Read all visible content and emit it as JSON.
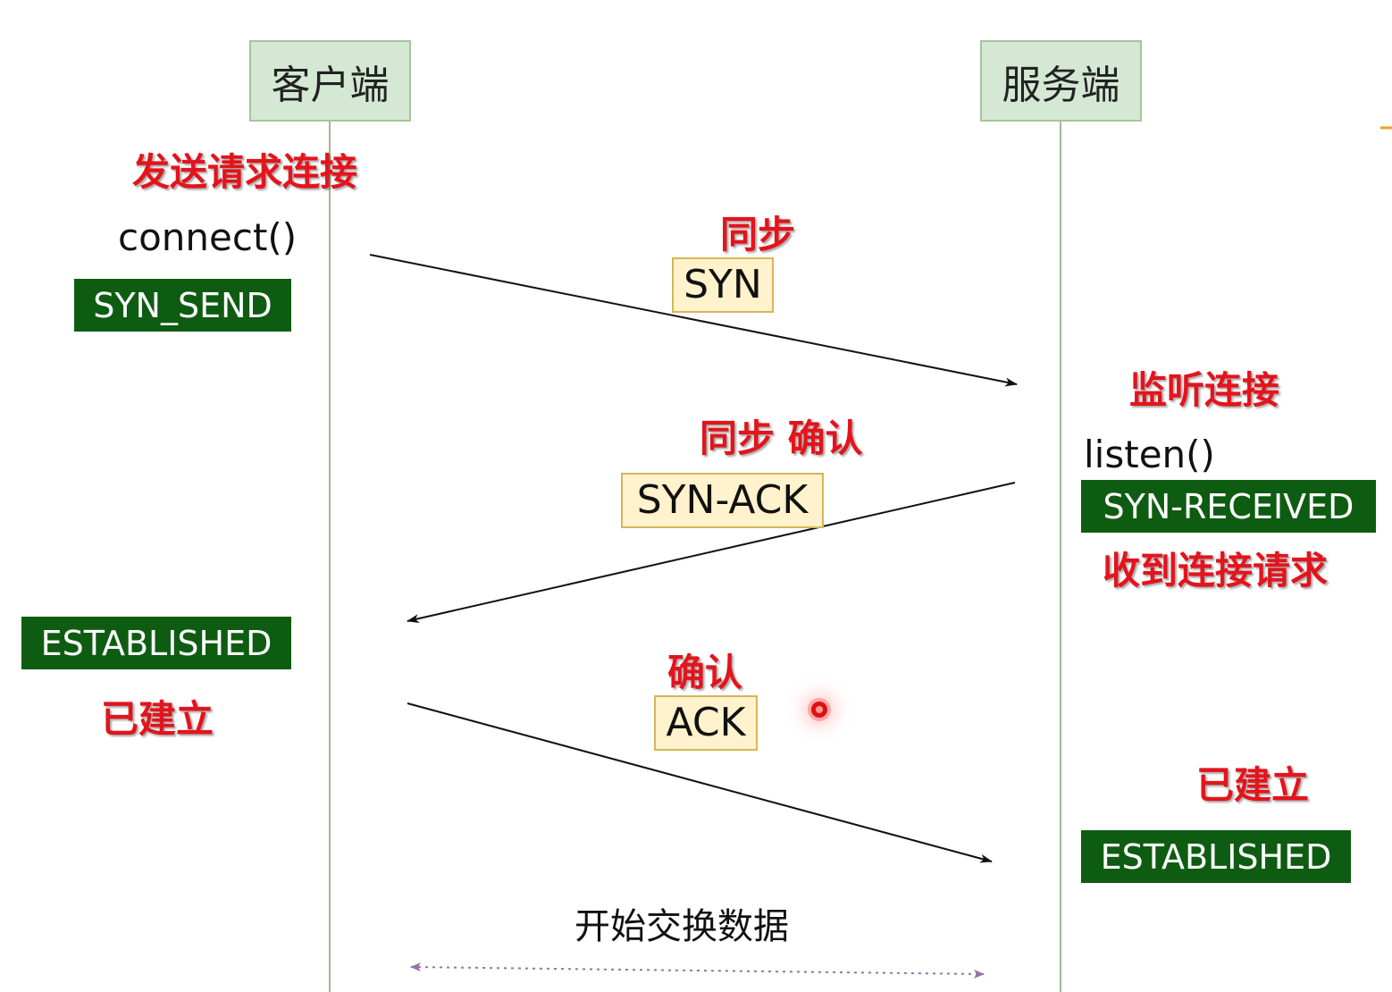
{
  "client": {
    "label": "客户端",
    "send_note": "发送请求连接",
    "call": "connect()",
    "state_initial": "SYN_SEND",
    "state_final": "ESTABLISHED",
    "established_note": "已建立"
  },
  "server": {
    "label": "服务端",
    "listen_note": "监听连接",
    "call": "listen()",
    "state_received": "SYN-RECEIVED",
    "received_note": "收到连接请求",
    "established_note": "已建立",
    "state_final": "ESTABLISHED"
  },
  "messages": [
    {
      "note": "同步",
      "packet": "SYN",
      "direction": "client-to-server"
    },
    {
      "note": "同步 确认",
      "packet": "SYN-ACK",
      "direction": "server-to-client"
    },
    {
      "note": "确认",
      "packet": "ACK",
      "direction": "client-to-server"
    }
  ],
  "data_exchange": {
    "label": "开始交换数据"
  },
  "colors": {
    "header_fill": "#d5e8d4",
    "header_border": "#a6c39b",
    "lifeline": "#9fb893",
    "red_note": "#e3141c",
    "state_badge": "#0e5c12",
    "packet_fill": "#fff2cc",
    "packet_border": "#d6b656",
    "dotted_arrow": "#9673a6"
  }
}
